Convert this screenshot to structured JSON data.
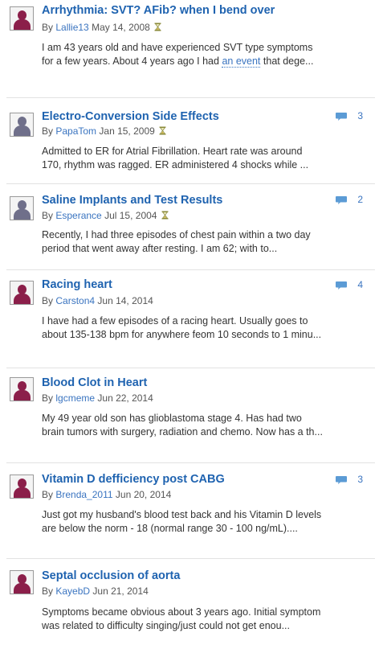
{
  "posts": [
    {
      "title": "Arrhythmia: SVT? AFib? when I bend over",
      "by": "By",
      "user": "Lallie13",
      "date": "May 14, 2008",
      "hourglass": true,
      "avatar": "female-avatar",
      "excerpt_before": "I am 43 years old and have experienced SVT type symptoms for a few years. About 4 years ago I had ",
      "excerpt_link": "an event",
      "excerpt_after": " that dege...",
      "comments": ""
    },
    {
      "title": "Electro-Conversion Side Effects",
      "by": "By",
      "user": "PapaTom",
      "date": "Jan 15, 2009",
      "hourglass": true,
      "avatar": "male-avatar",
      "excerpt_before": "Admitted to ER for Atrial Fibrillation. Heart rate was around 170, rhythm was ragged. ER administered 4 shocks while ...",
      "excerpt_link": "",
      "excerpt_after": "",
      "comments": "3"
    },
    {
      "title": "Saline Implants and Test Results",
      "by": "By",
      "user": "Esperance",
      "date": "Jul 15, 2004",
      "hourglass": true,
      "avatar": "male-avatar",
      "excerpt_before": "Recently, I had three episodes of chest pain within a two day period that went away after resting. I am 62; with to...",
      "excerpt_link": "",
      "excerpt_after": "",
      "comments": "2"
    },
    {
      "title": "Racing heart",
      "by": "By",
      "user": "Carston4",
      "date": "Jun 14, 2014",
      "hourglass": false,
      "avatar": "female-avatar",
      "excerpt_before": "I have had a few episodes of a racing heart. Usually goes to about 135-138 bpm for anywhere feom 10 seconds to 1 minu...",
      "excerpt_link": "",
      "excerpt_after": "",
      "comments": "4"
    },
    {
      "title": "Blood Clot in Heart",
      "by": "By",
      "user": "lgcmeme",
      "date": "Jun 22, 2014",
      "hourglass": false,
      "avatar": "female-avatar",
      "excerpt_before": "My 49 year old son has glioblastoma stage 4. Has had two brain tumors with surgery, radiation and chemo. Now has a th...",
      "excerpt_link": "",
      "excerpt_after": "",
      "comments": ""
    },
    {
      "title": "Vitamin D defficiency post CABG",
      "by": "By",
      "user": "Brenda_2011",
      "date": "Jun 20, 2014",
      "hourglass": false,
      "avatar": "female-avatar",
      "excerpt_before": "Just got my husband's blood test back and his Vitamin D levels are below the norm - 18 (normal range 30 - 100 ng/mL)....",
      "excerpt_link": "",
      "excerpt_after": "",
      "comments": "3"
    },
    {
      "title": "Septal occlusion of aorta",
      "by": "By",
      "user": "KayebD",
      "date": "Jun 21, 2014",
      "hourglass": false,
      "avatar": "female-avatar",
      "excerpt_before": "Symptoms became obvious about 3 years ago. Initial symptom was related to difficulty singing/just could not get enou...",
      "excerpt_link": "",
      "excerpt_after": "",
      "comments": ""
    }
  ],
  "colors": {
    "title": "#1f63b0",
    "link": "#3a74c0",
    "comment_icon": "#5b9bd5",
    "hourglass": "#8a8a3a"
  }
}
